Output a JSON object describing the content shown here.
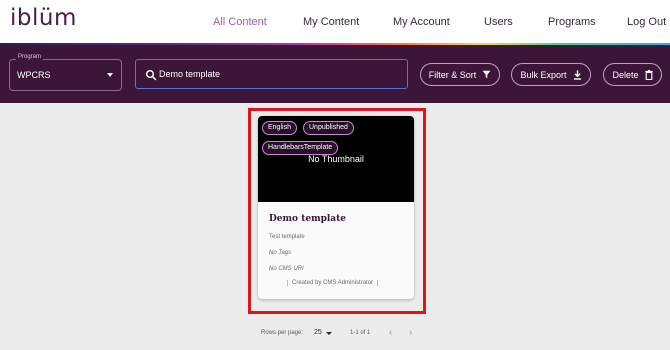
{
  "brand": {
    "logo_text": "iblüm",
    "accent": "#a15bbf",
    "toolbar_bg": "#3b1638"
  },
  "nav": {
    "items": [
      {
        "label": "All Content",
        "active": true
      },
      {
        "label": "My Content",
        "active": false
      },
      {
        "label": "My Account",
        "active": false
      },
      {
        "label": "Users",
        "active": false
      },
      {
        "label": "Programs",
        "active": false
      },
      {
        "label": "Log Out",
        "active": false
      }
    ]
  },
  "toolbar": {
    "program_label": "Program",
    "program_value": "WPCRS",
    "search_value": "Demo template",
    "filter_label": "Filter & Sort",
    "bulk_export_label": "Bulk Export",
    "delete_label": "Delete"
  },
  "card": {
    "chips": [
      "English",
      "Unpublished",
      "HandlebarsTemplate"
    ],
    "thumbnail_text": "No Thumbnail",
    "title": "Demo template",
    "description": "Test template",
    "tags": "No Tags",
    "cms_uri": "No CMS URI",
    "created_by": "Created by CMS Administrator"
  },
  "pagination": {
    "rows_label": "Rows per page:",
    "rows_value": "25",
    "range": "1-1 of 1",
    "prev_icon": "chevron-left-icon",
    "next_icon": "chevron-right-icon"
  }
}
